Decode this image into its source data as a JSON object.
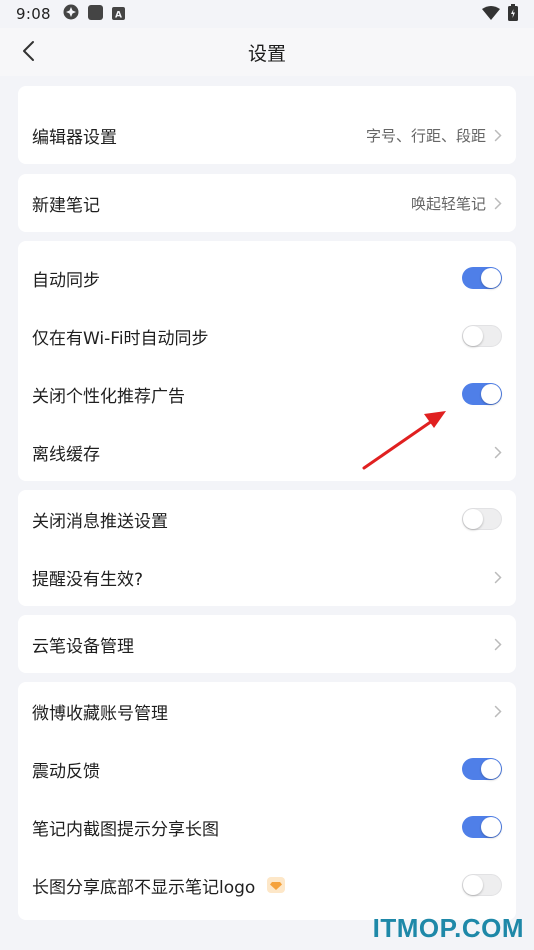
{
  "status_bar": {
    "time": "9:08",
    "icons_left": [
      "settings-gear-status-icon",
      "square-status-icon",
      "a-status-icon"
    ],
    "icons_right": [
      "wifi-icon",
      "battery-icon"
    ]
  },
  "header": {
    "title": "设置",
    "back_icon": "chevron-left-icon"
  },
  "groups": {
    "editor": {
      "label": "编辑器设置",
      "value": "字号、行距、段距"
    },
    "new_note": {
      "label": "新建笔记",
      "value": "唤起轻笔记"
    },
    "sync": {
      "auto_sync": {
        "label": "自动同步",
        "toggle_on": true
      },
      "wifi_sync": {
        "label": "仅在有Wi-Fi时自动同步",
        "toggle_on": false
      },
      "close_ads": {
        "label": "关闭个性化推荐广告",
        "toggle_on": true
      },
      "offline_cache": {
        "label": "离线缓存"
      }
    },
    "notify": {
      "close_push": {
        "label": "关闭消息推送设置",
        "toggle_on": false
      },
      "reminder": {
        "label": "提醒没有生效?"
      }
    },
    "pen": {
      "device": {
        "label": "云笔设备管理"
      }
    },
    "misc": {
      "weibo": {
        "label": "微博收藏账号管理"
      },
      "vibration": {
        "label": "震动反馈",
        "toggle_on": true
      },
      "screenshot_share": {
        "label": "笔记内截图提示分享长图",
        "toggle_on": true
      },
      "hide_logo": {
        "label": "长图分享底部不显示笔记logo",
        "toggle_on": false,
        "badge_icon": "diamond-vip-icon"
      }
    }
  },
  "colors": {
    "accent": "#4f7fe8",
    "background": "#f3f4f8",
    "card": "#ffffff",
    "arrow": "#e02020",
    "watermark": "#1e88a8"
  },
  "watermark": "ITMOP.COM"
}
